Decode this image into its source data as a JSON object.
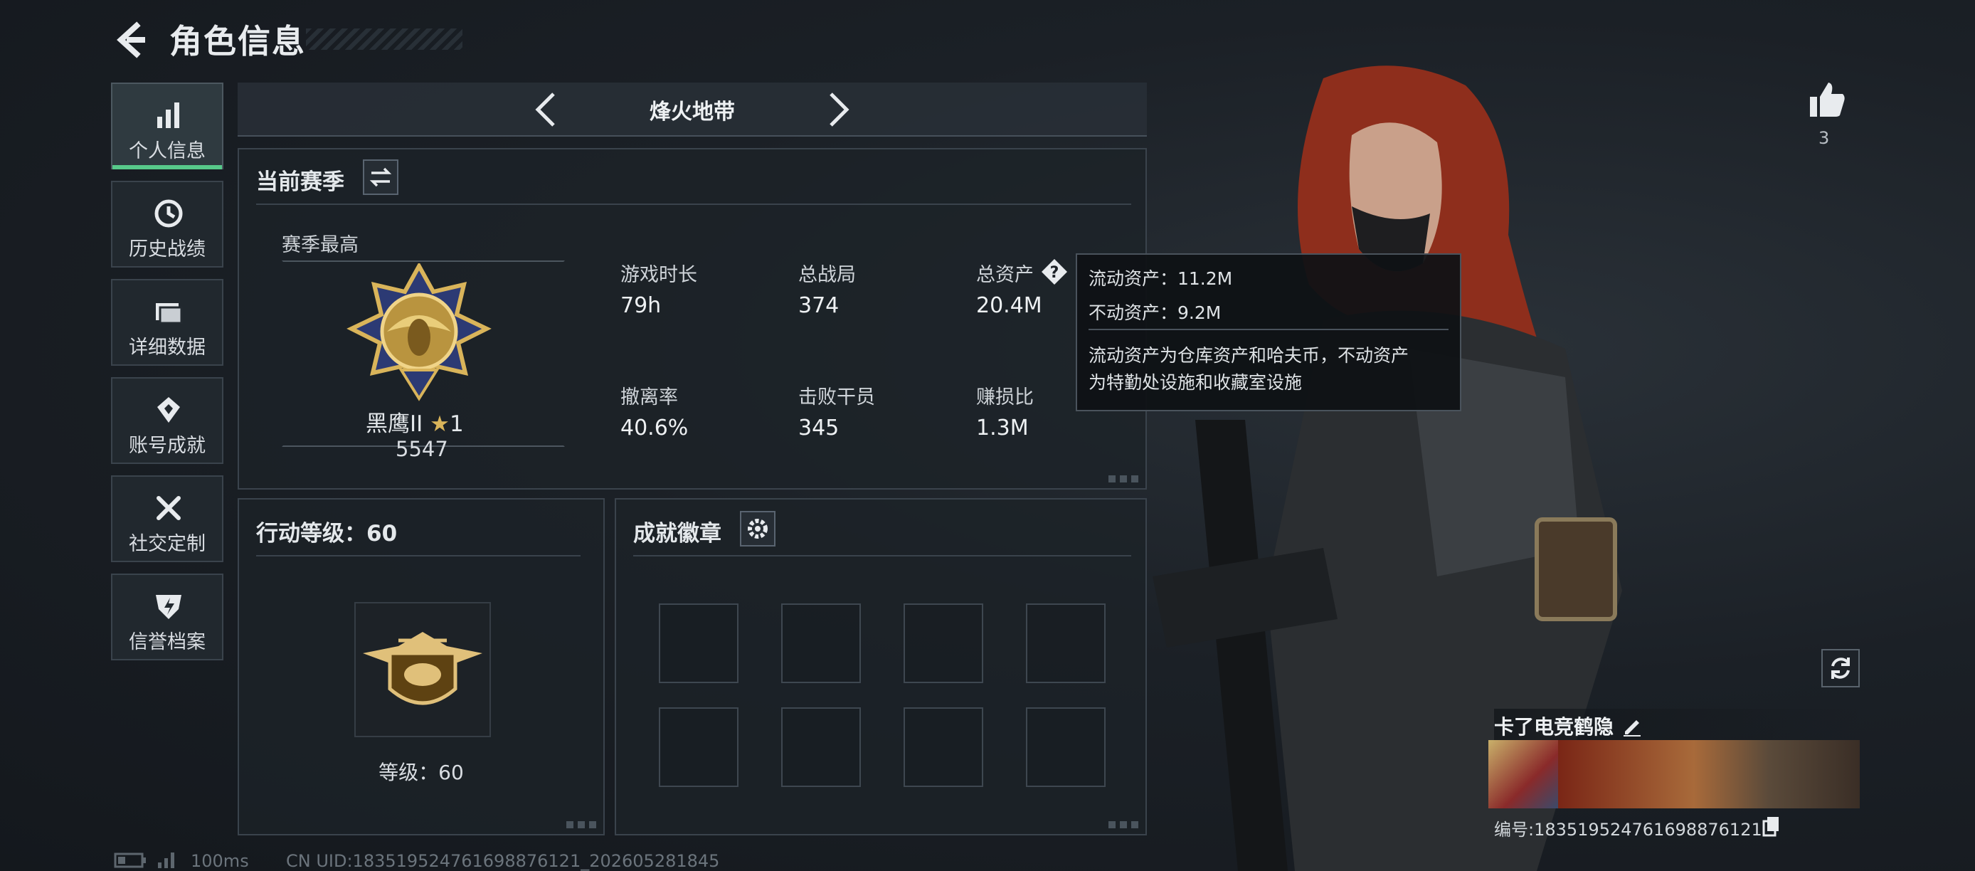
{
  "header": {
    "title": "角色信息"
  },
  "sidebar": {
    "items": [
      {
        "label": "个人信息",
        "icon": "bar-chart-icon",
        "active": true
      },
      {
        "label": "历史战绩",
        "icon": "history-icon",
        "active": false
      },
      {
        "label": "详细数据",
        "icon": "folder-icon",
        "active": false
      },
      {
        "label": "账号成就",
        "icon": "achievement-icon",
        "active": false
      },
      {
        "label": "社交定制",
        "icon": "tools-icon",
        "active": false
      },
      {
        "label": "信誉档案",
        "icon": "credit-shield-icon",
        "active": false
      }
    ]
  },
  "mode": {
    "label": "烽火地带"
  },
  "season": {
    "title": "当前赛季",
    "best_label": "赛季最高",
    "rank_name": "黑鹰II",
    "rank_stars": "1",
    "rank_score": "5547",
    "stats": [
      {
        "label": "游戏时长",
        "value": "79h"
      },
      {
        "label": "总战局",
        "value": "374"
      },
      {
        "label": "总资产",
        "value": "20.4M"
      },
      {
        "label": "撤离率",
        "value": "40.6%"
      },
      {
        "label": "击败干员",
        "value": "345"
      },
      {
        "label": "赚损比",
        "value": "1.3M"
      }
    ]
  },
  "tooltip": {
    "liquid": "流动资产：11.2M",
    "fixed": "不动资产：9.2M",
    "desc_line1": "流动资产为仓库资产和哈夫币，不动资产",
    "desc_line2": "为特勤处设施和收藏室设施"
  },
  "action_level": {
    "title": "行动等级：60",
    "level_label": "等级：60"
  },
  "badges": {
    "title": "成就徽章"
  },
  "likes": {
    "count": "3"
  },
  "player": {
    "name": "卡了电竞鹤隐",
    "id": "编号:1835195247616988761​21"
  },
  "footer": {
    "ping": "100ms",
    "uid": "CN UID:18351952476169887612​1_202605281845"
  },
  "colors": {
    "accent": "#57c98a",
    "panel_border": "#3a434c",
    "gold": "#d9b45a"
  }
}
